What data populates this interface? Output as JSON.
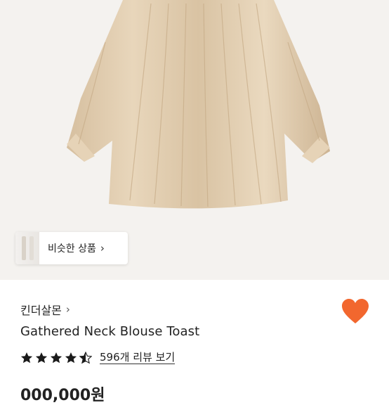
{
  "product": {
    "image_alt": "Gathered Neck Blouse Toast",
    "similar_label": "비슷한 상품",
    "brand": "킨더살몬",
    "title": "Gathered Neck Blouse Toast",
    "rating": 4.5,
    "reviews_label": "596개 리뷰 보기",
    "heart_color": "#f2672e",
    "price": "000,000원"
  },
  "icons": {
    "similar_chevron": "›",
    "brand_chevron": "›"
  }
}
